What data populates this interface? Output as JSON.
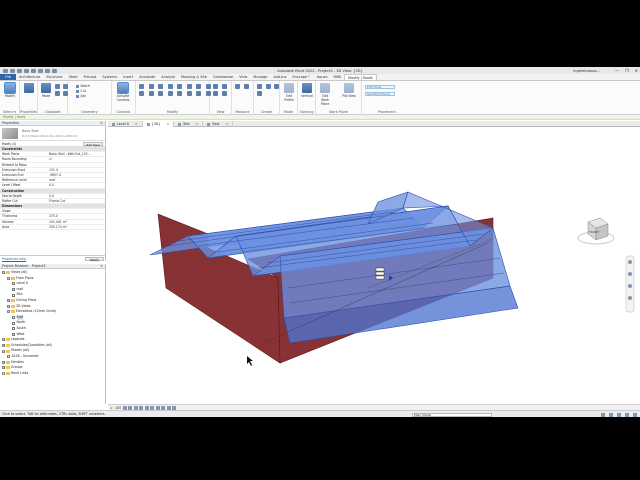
{
  "titlebar": {
    "title": "Autodesk Revit 2022 - Project3 - 3D View: {3D}",
    "user": "ingeleiroosss...",
    "minimize": "—",
    "maximize": "❐",
    "close": "✕"
  },
  "tabs": [
    "File",
    "Architecture",
    "Structure",
    "Steel",
    "Precast",
    "Systems",
    "Insert",
    "Annotate",
    "Analyze",
    "Massing & Site",
    "Collaborate",
    "View",
    "Manage",
    "Add-Ins",
    "Enscape™",
    "Issues",
    "MBS",
    "Modify | Roofs"
  ],
  "active_tab": "Modify | Roofs",
  "ribbon": {
    "modify_label": "Modify",
    "paste_label": "Paste",
    "join_label": "Join",
    "select_label": "Select ▾",
    "properties_label": "Properties",
    "clipboard_label": "Clipboard",
    "geometry_label": "Geometry",
    "controls_btn": "Activate Controls",
    "controls_label": "Controls",
    "modify_group_label": "Modify",
    "view_label": "View",
    "measure_label": "Measure",
    "create_label": "Create",
    "mode_label": "Mode",
    "opening_label": "Opening",
    "workplane_label": "Work Plane",
    "placement_label": "Placement",
    "geometry_items": [
      "Notch",
      "Cut",
      "Join"
    ],
    "edit_profile": "Edit Profile",
    "vertical": "Vertical",
    "edit_workplane": "Edit Work Plane",
    "pick_new": "Pick New",
    "field1": "Edit Tools",
    "field2": "Set Work Plane"
  },
  "context_bar": "Modify | Roofs",
  "properties": {
    "header": "Properties",
    "close": "✕",
    "type_family": "Basic Roof",
    "type_name": "Roof_Metal-SSS-0.8m-40mm-ZZRmm",
    "filter": "Roofs (1)",
    "edit_type": "Edit Type",
    "rows": [
      {
        "k": "Constraints",
        "v": "",
        "cat": true
      },
      {
        "k": "Work Plane",
        "v": "Basic Wall : Wall-Ext_102..."
      },
      {
        "k": "Room Bounding",
        "v": "☑"
      },
      {
        "k": "Related to Mass",
        "v": ""
      },
      {
        "k": "Extrusion Start",
        "v": "151.4"
      },
      {
        "k": "Extrusion End",
        "v": "-9857.4"
      },
      {
        "k": "Reference Level",
        "v": "roof"
      },
      {
        "k": "Level Offset",
        "v": "0.0"
      },
      {
        "k": "Construction",
        "v": "",
        "cat": true
      },
      {
        "k": "Fascia Depth",
        "v": "0.0"
      },
      {
        "k": "Rafter Cut",
        "v": "Plumb Cut"
      },
      {
        "k": "Dimensions",
        "v": "",
        "cat": true
      },
      {
        "k": "Slope",
        "v": ""
      },
      {
        "k": "Thickness",
        "v": "375.0"
      },
      {
        "k": "Volume",
        "v": "101.441 m³"
      },
      {
        "k": "Area",
        "v": "350.174 m²"
      }
    ],
    "help": "Properties help",
    "apply": "Apply"
  },
  "browser": {
    "header": "Project Browser - Project3",
    "close": "✕",
    "nodes": [
      {
        "label": "Views (all)",
        "level": 0,
        "type": "folder",
        "tw": "−"
      },
      {
        "label": "Floor Plans",
        "level": 1,
        "type": "folder",
        "tw": "−"
      },
      {
        "label": "Level 0",
        "level": 2,
        "type": "view"
      },
      {
        "label": "roof",
        "level": 2,
        "type": "view"
      },
      {
        "label": "Site",
        "level": 2,
        "type": "view"
      },
      {
        "label": "Ceiling Plans",
        "level": 1,
        "type": "folder",
        "tw": "+"
      },
      {
        "label": "3D Views",
        "level": 1,
        "type": "folder",
        "tw": "+"
      },
      {
        "label": "Elevations (12mm Circle)",
        "level": 1,
        "type": "folder",
        "tw": "−"
      },
      {
        "label": "East",
        "level": 2,
        "type": "view",
        "sel": true
      },
      {
        "label": "North",
        "level": 2,
        "type": "view"
      },
      {
        "label": "South",
        "level": 2,
        "type": "view"
      },
      {
        "label": "West",
        "level": 2,
        "type": "view"
      },
      {
        "label": "Legends",
        "level": 0,
        "type": "folder",
        "tw": "+"
      },
      {
        "label": "Schedules/Quantities (all)",
        "level": 0,
        "type": "folder",
        "tw": "+"
      },
      {
        "label": "Sheets (all)",
        "level": 0,
        "type": "folder",
        "tw": "−"
      },
      {
        "label": "A100 - Unnamed",
        "level": 1,
        "type": "view"
      },
      {
        "label": "Families",
        "level": 0,
        "type": "folder",
        "tw": "+"
      },
      {
        "label": "Groups",
        "level": 0,
        "type": "folder",
        "tw": "+"
      },
      {
        "label": "Revit Links",
        "level": 0,
        "type": "folder",
        "tw": ""
      }
    ]
  },
  "doc_tabs": [
    {
      "label": "Level 0",
      "active": false
    },
    {
      "label": "{3D}",
      "active": true
    },
    {
      "label": "Site",
      "active": false
    },
    {
      "label": "East",
      "active": false
    }
  ],
  "viewcube": {
    "face": "FRONT",
    "right": "RIGHT"
  },
  "viewbar": "1 : 100",
  "status": {
    "text": "Click to select, TAB for alternates, CTRL adds, SHIFT unselects.",
    "model": "Main Model",
    "filter": "▼:0"
  },
  "colors": {
    "accent": "#2f64a8",
    "roof": "#5b7fd8",
    "wall": "#8a2f2f"
  }
}
